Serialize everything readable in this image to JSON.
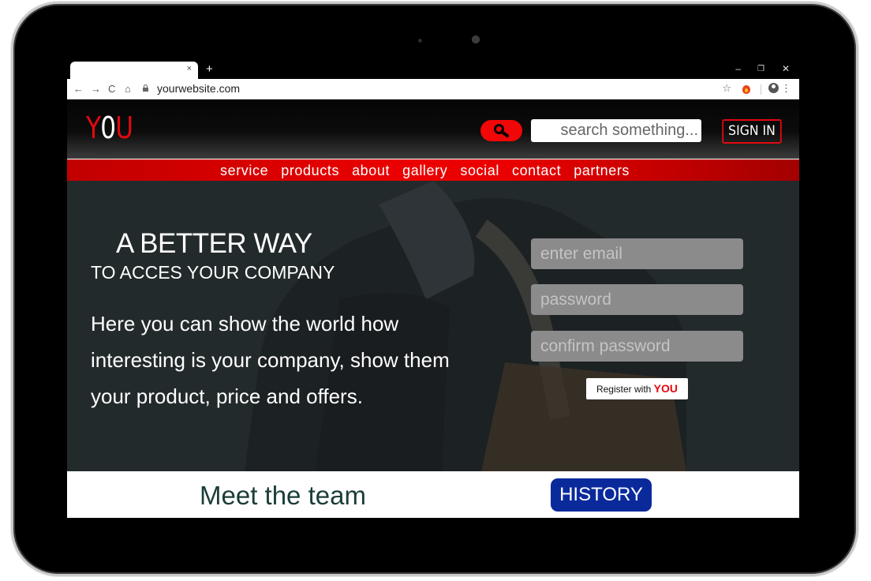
{
  "browser": {
    "tab_close": "×",
    "new_tab": "+",
    "window_controls": {
      "minimize": "–",
      "maximize": "❐",
      "close": "✕"
    },
    "nav": {
      "back": "←",
      "forward": "→",
      "reload": "C",
      "home": "⌂"
    },
    "url": "yourwebsite.com",
    "bookmark": "☆",
    "menu": "⋮"
  },
  "site": {
    "logo": {
      "y": "Y",
      "o": "0",
      "u": "U"
    },
    "search": {
      "placeholder": "search something..."
    },
    "signin_label": "SIGN IN",
    "nav_items": [
      "service",
      "products",
      "about",
      "gallery",
      "social",
      "contact",
      "partners"
    ],
    "colors": {
      "brand_red": "#e3080f",
      "nav_blue": "#0a2a9c",
      "team_text": "#1b3d38"
    }
  },
  "hero": {
    "title": "A BETTER WAY",
    "subtitle": "TO ACCES YOUR COMPANY",
    "body": "Here you can show the world how interesting is your company, show them your product, price and offers.",
    "form": {
      "email_placeholder": "enter email",
      "password_placeholder": "password",
      "confirm_placeholder": "confirm password",
      "register_prefix": "Register with",
      "register_brand": "YOU"
    }
  },
  "bottom": {
    "team": "Meet the team",
    "history": "HISTORY"
  }
}
